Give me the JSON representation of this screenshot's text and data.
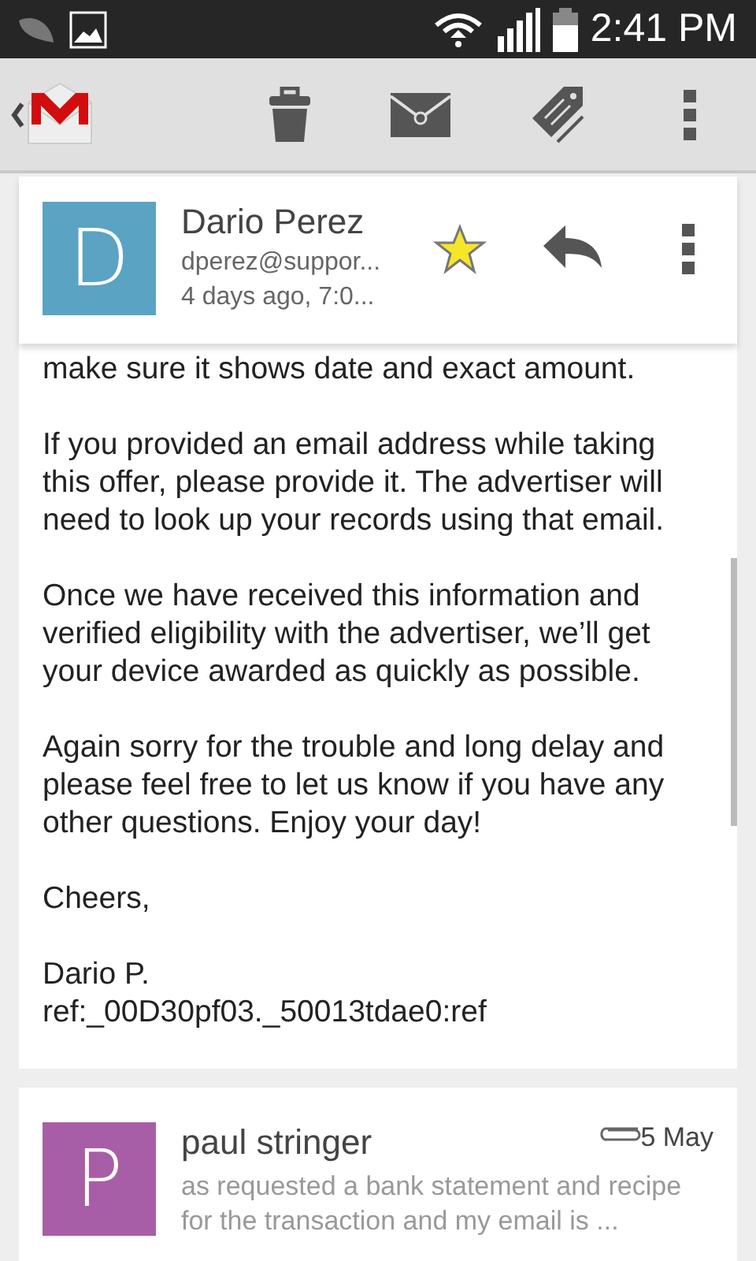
{
  "status_bar": {
    "time": "2:41 PM"
  },
  "message": {
    "sender": "Dario Perez",
    "initial": "D",
    "email": "dperez@suppor...",
    "date": "4 days ago, 7:0...",
    "starred": true,
    "paragraphs": [
      "make sure it shows date and exact amount.",
      "If you provided an email address while taking this offer, please provide it. The advertiser will need to look up your records using that email.",
      "Once we have received this information and verified eligibility with the advertiser, we’ll get your device awarded as quickly as possible.",
      "Again sorry for the trouble and long delay  and please feel free to let us know if you have any other questions. Enjoy your day!",
      "Cheers,"
    ],
    "signature": [
      "Dario P.",
      "ref:_00D30pf03._50013tdae0:ref"
    ]
  },
  "next_message": {
    "sender": "paul stringer",
    "initial": "P",
    "date": "5 May",
    "has_attachment": true,
    "snippet": "as requested a bank statement and recipe for the transaction and my email is ..."
  }
}
